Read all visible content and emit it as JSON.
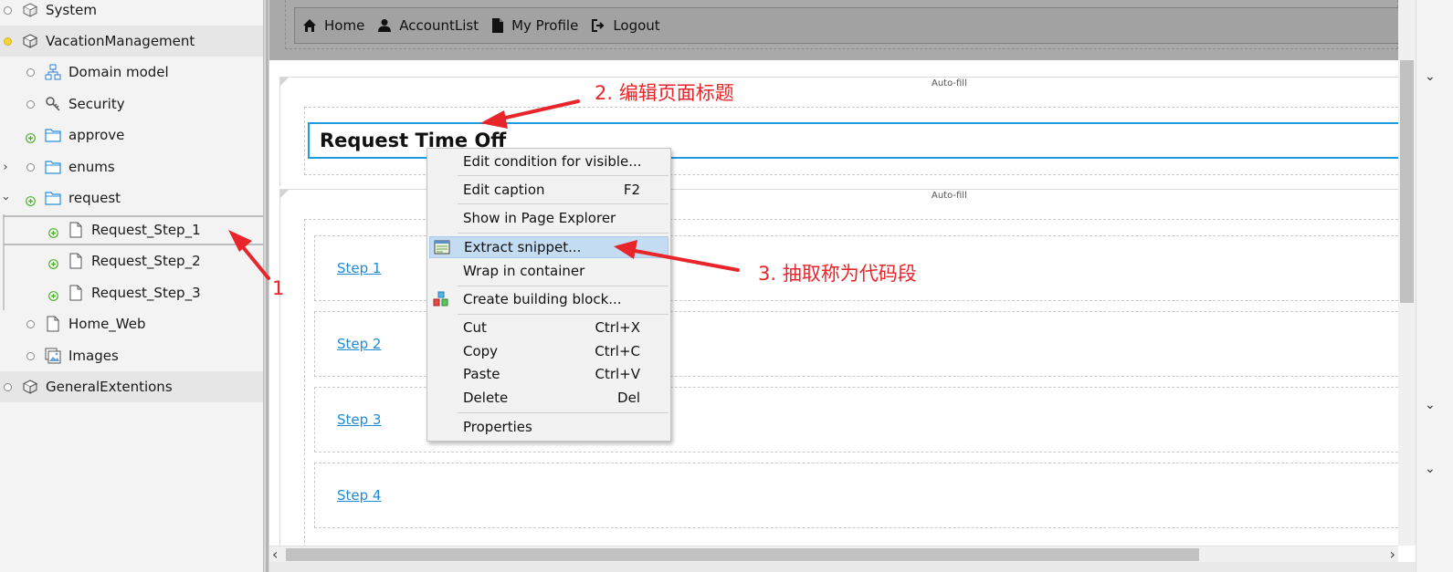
{
  "tree": {
    "items": [
      {
        "label": "System"
      },
      {
        "label": "VacationManagement"
      },
      {
        "label": "Domain model"
      },
      {
        "label": "Security"
      },
      {
        "label": "approve"
      },
      {
        "label": "enums"
      },
      {
        "label": "request"
      },
      {
        "label": "Request_Step_1"
      },
      {
        "label": "Request_Step_2"
      },
      {
        "label": "Request_Step_3"
      },
      {
        "label": "Home_Web"
      },
      {
        "label": "Images"
      },
      {
        "label": "GeneralExtentions"
      }
    ]
  },
  "navbar": {
    "items": [
      {
        "label": "Home",
        "icon": "home-icon"
      },
      {
        "label": "AccountList",
        "icon": "user-icon"
      },
      {
        "label": "My Profile",
        "icon": "document-icon"
      },
      {
        "label": "Logout",
        "icon": "logout-icon"
      }
    ]
  },
  "page": {
    "autofill_label": "Auto-fill",
    "title": "Request Time Off",
    "steps": [
      "Step 1",
      "Step 2",
      "Step 3",
      "Step 4"
    ]
  },
  "context_menu": {
    "items": [
      {
        "label": "Edit condition for visible...",
        "shortcut": ""
      },
      {
        "label": "Edit caption",
        "shortcut": "F2"
      },
      {
        "label": "Show in Page Explorer",
        "shortcut": ""
      },
      {
        "label": "Extract snippet...",
        "shortcut": "",
        "icon": "snippet-icon"
      },
      {
        "label": "Wrap in container",
        "shortcut": ""
      },
      {
        "label": "Create building block...",
        "shortcut": "",
        "icon": "building-block-icon"
      },
      {
        "label": "Cut",
        "shortcut": "Ctrl+X"
      },
      {
        "label": "Copy",
        "shortcut": "Ctrl+C"
      },
      {
        "label": "Paste",
        "shortcut": "Ctrl+V"
      },
      {
        "label": "Delete",
        "shortcut": "Del"
      },
      {
        "label": "Properties",
        "shortcut": ""
      }
    ],
    "selected": "Extract snippet..."
  },
  "annotations": {
    "step1": "1",
    "step2": "2. 编辑页面标题",
    "step3": "3. 抽取称为代码段"
  },
  "colors": {
    "annotation": "#e8252a",
    "title_border": "#1e9ae0",
    "link": "#1e8bd6",
    "menu_selected": "#c4dcf2"
  }
}
